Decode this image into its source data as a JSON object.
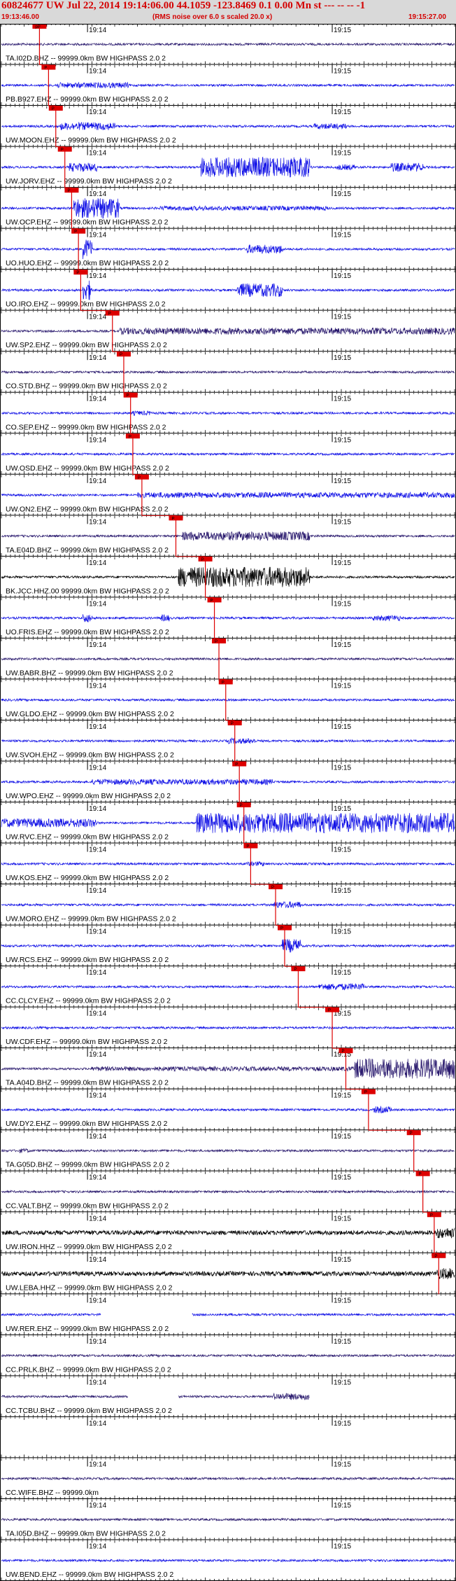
{
  "header": {
    "title": "60824677 UW Jul 22, 2014 19:14:06.00   44.1059 -123.8469  0.1 0.00 Mn st --- -- --  -1",
    "start_time": "19:13:46.00",
    "note": "(RMS noise over 6.0 s scaled 20.0 x)",
    "end_time": "19:15:27.00"
  },
  "chart_data": {
    "type": "line",
    "title": "60824677 UW Jul 22, 2014 19:14:06.00   44.1059 -123.8469  0.1 0.00 Mn st --- -- --  -1",
    "x_range": [
      "19:13:46.00",
      "19:15:27.00"
    ],
    "minute_labels": [
      "19:14",
      "19:15"
    ],
    "colors": {
      "blue": "#1010e6",
      "navy": "#2a1a6e",
      "black": "#000000",
      "pick": "#dd0000"
    },
    "traces": [
      {
        "label": "TA.I02D.BHZ -- 99999.0km BW  HIGHPASS  2.0  2",
        "color": "navy",
        "pick": "pP",
        "pick_frac": 0.084,
        "activity": []
      },
      {
        "label": "PB.B927.EHZ -- 99999.0km BW  HIGHPASS  2.0  2",
        "color": "blue",
        "pick": "P",
        "pick_frac": 0.104,
        "activity": [
          [
            0.12,
            0.28,
            2.5
          ]
        ]
      },
      {
        "label": "UW.MOON.EHZ -- 99999.0km BW  HIGHPASS  2.0  2",
        "color": "blue",
        "pick": "P",
        "pick_frac": 0.12,
        "activity": [
          [
            0.13,
            0.25,
            3.5
          ],
          [
            0.69,
            0.76,
            2.5
          ]
        ]
      },
      {
        "label": "UW.JORV.EHZ -- 99999.0km BW  HIGHPASS  2.0  2",
        "color": "blue",
        "pick": "P",
        "pick_frac": 0.14,
        "activity": [
          [
            0.15,
            0.21,
            4
          ],
          [
            0.44,
            0.68,
            9
          ],
          [
            0.74,
            0.78,
            2.5
          ],
          [
            0.86,
            0.93,
            4
          ]
        ]
      },
      {
        "label": "UW.OCP.EHZ -- 99999.0km BW  HIGHPASS  2.0  2",
        "color": "blue",
        "pick": "P",
        "pick_frac": 0.155,
        "activity": [
          [
            0.16,
            0.26,
            9
          ],
          [
            0.35,
            0.72,
            2
          ]
        ]
      },
      {
        "label": "UO.HUO.EHZ -- 99999.0km BW  HIGHPASS  2.0  2",
        "color": "blue",
        "pick": "P",
        "pick_frac": 0.17,
        "activity": [
          [
            0.18,
            0.2,
            9
          ],
          [
            0.54,
            0.62,
            4
          ]
        ]
      },
      {
        "label": "UO.IRO.EHZ -- 99999.0km BW  HIGHPASS  2.0  2",
        "color": "blue",
        "pick": "P",
        "pick_frac": 0.175,
        "activity": [
          [
            0.18,
            0.2,
            9
          ],
          [
            0.52,
            0.62,
            6
          ]
        ]
      },
      {
        "label": "UW.SP2.EHZ -- 99999.0km BW  HIGHPASS  2.0  2",
        "color": "navy",
        "pick": "P",
        "pick_frac": 0.245,
        "activity": [
          [
            0.26,
            1.0,
            3
          ]
        ]
      },
      {
        "label": "CO.STD.BHZ -- 99999.0km BW  HIGHPASS  2.0  2",
        "color": "navy",
        "pick": "P",
        "pick_frac": 0.27,
        "activity": []
      },
      {
        "label": "CO.SEP.EHZ -- 99999.0km BW  HIGHPASS  2.0  2",
        "color": "blue",
        "pick": "P",
        "pick_frac": 0.285,
        "activity": [
          [
            0.29,
            0.33,
            2
          ]
        ]
      },
      {
        "label": "UW.OSD.EHZ -- 99999.0km BW  HIGHPASS  2.0  2",
        "color": "blue",
        "pick": "P",
        "pick_frac": 0.29,
        "activity": []
      },
      {
        "label": "UW.ON2.EHZ -- 99999.0km BW  HIGHPASS  2.0  2",
        "color": "blue",
        "pick": "P",
        "pick_frac": 0.31,
        "activity": [
          [
            0.3,
            1.0,
            2.5
          ]
        ]
      },
      {
        "label": "TA.E04D.BHZ -- 99999.0km BW  HIGHPASS  2.0  2",
        "color": "navy",
        "pick": "P",
        "pick_frac": 0.385,
        "activity": [
          [
            0.4,
            0.68,
            4
          ]
        ]
      },
      {
        "label": "BK.JCC.HHZ.00 99999.0km BW  HIGHPASS  2.0  2",
        "color": "black",
        "pick": "P",
        "pick_frac": 0.45,
        "activity": [
          [
            0.39,
            0.68,
            9
          ]
        ]
      },
      {
        "label": "UO.FRIS.EHZ -- 99999.0km BW  HIGHPASS  2.0  2",
        "color": "blue",
        "pick": "P",
        "pick_frac": 0.47,
        "activity": [
          [
            0.18,
            0.2,
            4
          ],
          [
            0.35,
            0.37,
            3
          ],
          [
            0.82,
            0.88,
            2.5
          ]
        ]
      },
      {
        "label": "UW.BABR.BHZ -- 99999.0km BW  HIGHPASS  2.0  2",
        "color": "navy",
        "pick": "P",
        "pick_frac": 0.48,
        "activity": []
      },
      {
        "label": "UW.GLDO.EHZ -- 99999.0km BW  HIGHPASS  2.0  2",
        "color": "blue",
        "pick": "P",
        "pick_frac": 0.495,
        "activity": []
      },
      {
        "label": "UW.SVOH.EHZ -- 99999.0km BW  HIGHPASS  2.0  2",
        "color": "blue",
        "pick": "P",
        "pick_frac": 0.515,
        "activity": [
          [
            0.5,
            0.56,
            2.5
          ]
        ]
      },
      {
        "label": "UW.WPO.EHZ -- 99999.0km BW  HIGHPASS  2.0  2",
        "color": "blue",
        "pick": "P",
        "pick_frac": 0.525,
        "activity": [
          [
            0.2,
            0.6,
            2.5
          ]
        ]
      },
      {
        "label": "UW.RVC.EHZ -- 99999.0km BW  HIGHPASS  2.0  2",
        "color": "blue",
        "pick": "P",
        "pick_frac": 0.535,
        "activity": [
          [
            0.0,
            0.21,
            4
          ],
          [
            0.43,
            1.0,
            9
          ]
        ]
      },
      {
        "label": "UW.KOS.EHZ -- 99999.0km BW  HIGHPASS  2.0  2",
        "color": "blue",
        "pick": "P",
        "pick_frac": 0.55,
        "activity": [
          [
            0.54,
            0.58,
            2
          ]
        ]
      },
      {
        "label": "UW.MORO.EHZ -- 99999.0km BW  HIGHPASS  2.0  2",
        "color": "blue",
        "pick": "P",
        "pick_frac": 0.605,
        "activity": [
          [
            0.6,
            0.66,
            3
          ]
        ]
      },
      {
        "label": "UW.RCS.EHZ -- 99999.0km BW  HIGHPASS  2.0  2",
        "color": "blue",
        "pick": "P",
        "pick_frac": 0.625,
        "activity": [
          [
            0.62,
            0.66,
            6
          ]
        ]
      },
      {
        "label": "CC.CLCY.EHZ -- 99999.0km BW  HIGHPASS  2.0  2",
        "color": "blue",
        "pick": "P",
        "pick_frac": 0.655,
        "activity": [
          [
            0.7,
            0.8,
            3
          ]
        ]
      },
      {
        "label": "UW.CDF.EHZ -- 99999.0km BW  HIGHPASS  2.0  2",
        "color": "blue",
        "pick": "P",
        "pick_frac": 0.73,
        "activity": []
      },
      {
        "label": "TA.A04D.BHZ -- 99999.0km BW  HIGHPASS  2.0  2",
        "color": "navy",
        "pick": "P",
        "pick_frac": 0.76,
        "activity": [
          [
            0.2,
            0.78,
            2
          ],
          [
            0.78,
            1.0,
            9
          ]
        ]
      },
      {
        "label": "UW.DY2.EHZ -- 99999.0km BW  HIGHPASS  2.0  2",
        "color": "blue",
        "pick": "P",
        "pick_frac": 0.81,
        "activity": [
          [
            0.82,
            0.86,
            3
          ]
        ]
      },
      {
        "label": "TA.G05D.BHZ -- 99999.0km BW  HIGHPASS  2.0  2",
        "color": "navy",
        "pick": "P",
        "pick_frac": 0.91,
        "activity": [
          [
            0.04,
            0.06,
            2
          ]
        ]
      },
      {
        "label": "CC.VALT.BHZ -- 99999.0km BW  HIGHPASS  2.0  2",
        "color": "navy",
        "pick": "P",
        "pick_frac": 0.93,
        "activity": []
      },
      {
        "label": "UW.IRON.HHZ -- 99999.0km BW  HIGHPASS  2.0  2",
        "color": "black",
        "pick": "P",
        "pick_frac": 0.955,
        "activity": [
          [
            0.0,
            1.0,
            2
          ],
          [
            0.96,
            1.0,
            5
          ]
        ]
      },
      {
        "label": "UW.LEBA.HHZ -- 99999.0km BW  HIGHPASS  2.0  2",
        "color": "black",
        "pick": "P",
        "pick_frac": 0.965,
        "activity": [
          [
            0.0,
            1.0,
            2
          ],
          [
            0.96,
            1.0,
            5
          ]
        ]
      },
      {
        "label": "UW.RER.EHZ -- 99999.0km BW  HIGHPASS  2.0  2",
        "color": "blue",
        "pick": "",
        "pick_frac": null,
        "gaps": [
          [
            0.22,
            0.42
          ]
        ],
        "activity": []
      },
      {
        "label": "CC.PRLK.BHZ -- 99999.0km BW  HIGHPASS  2.0  2",
        "color": "navy",
        "pick": "",
        "pick_frac": null,
        "activity": []
      },
      {
        "label": "CC.TCBU.BHZ -- 99999.0km BW  HIGHPASS  2.0  2",
        "color": "navy",
        "pick": "",
        "pick_frac": null,
        "gaps": [
          [
            0.28,
            0.39
          ],
          [
            0.68,
            1.0
          ]
        ],
        "activity": [
          [
            0.6,
            0.68,
            3
          ]
        ]
      },
      {
        "label": "",
        "color": "navy",
        "pick": "",
        "pick_frac": null,
        "gaps": [
          [
            0.0,
            1.0
          ]
        ],
        "activity": []
      },
      {
        "label": "CC.WIFE.BHZ -- 99999.0km",
        "color": "navy",
        "pick": "",
        "pick_frac": null,
        "activity": []
      },
      {
        "label": "TA.I05D.BHZ -- 99999.0km BW  HIGHPASS  2.0  2",
        "color": "navy",
        "pick": "",
        "pick_frac": null,
        "activity": []
      },
      {
        "label": "UW.BEND.EHZ -- 99999.0km BW  HIGHPASS  2.0  2",
        "color": "blue",
        "pick": "",
        "pick_frac": null,
        "activity": []
      }
    ]
  }
}
